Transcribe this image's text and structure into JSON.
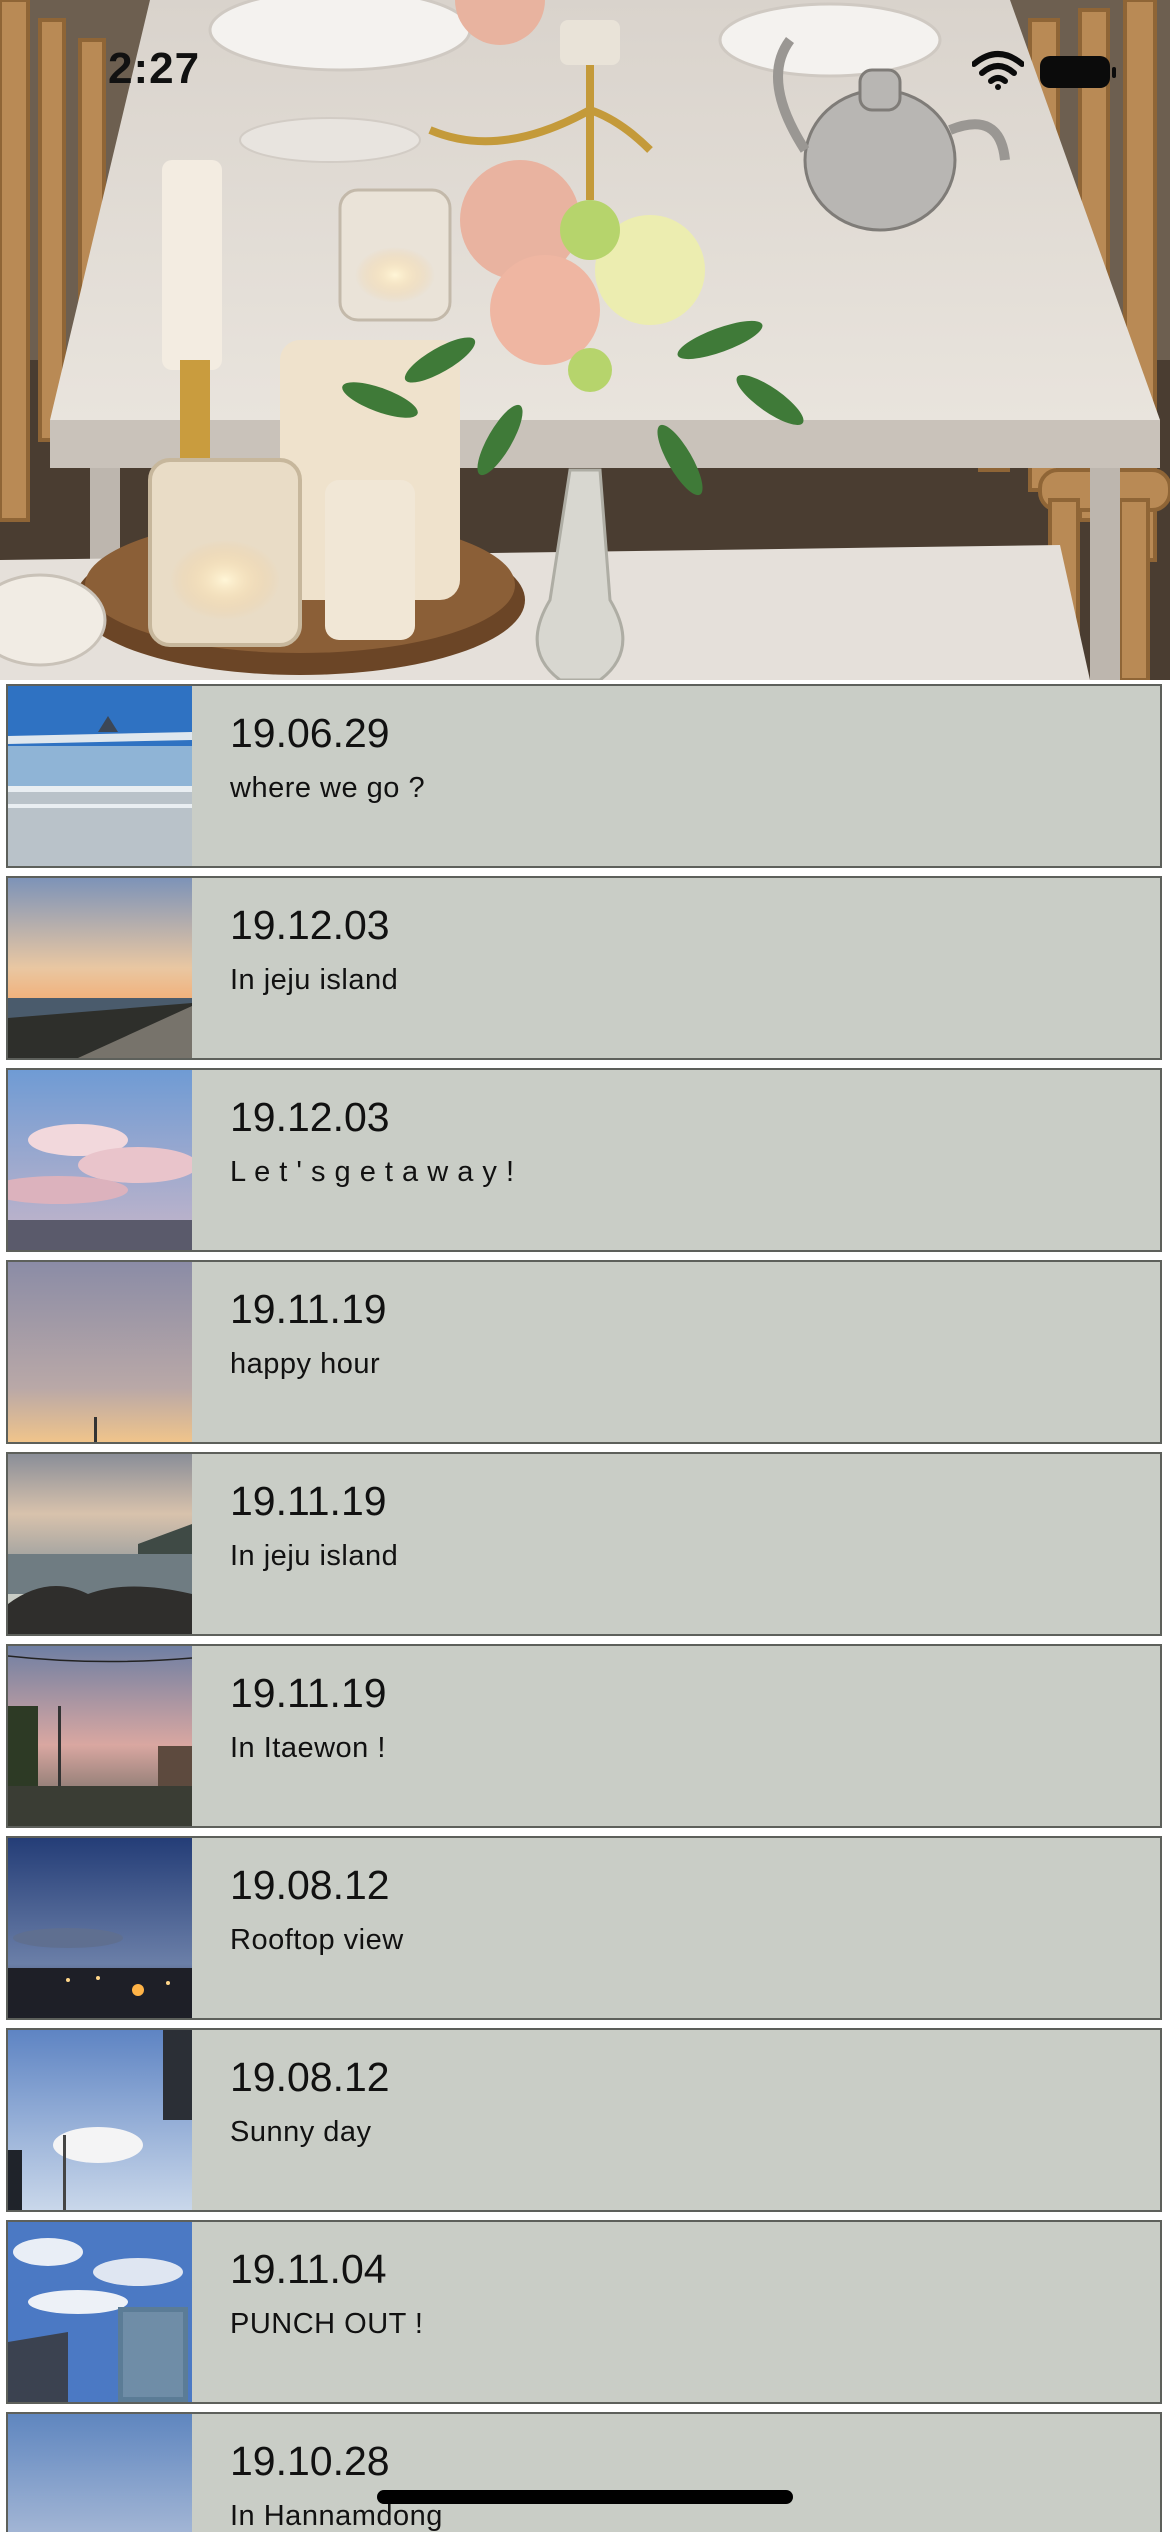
{
  "status_bar": {
    "time": "2:27",
    "wifi_icon": "wifi-icon",
    "battery_icon": "battery-icon"
  },
  "header": {
    "photo_icon": "dining-table-photo"
  },
  "entries": [
    {
      "date": "19.06.29",
      "caption": "where we go ?",
      "thumb": "bridge-sea-photo"
    },
    {
      "date": "19.12.03",
      "caption": "In jeju island",
      "thumb": "sunset-coast-photo"
    },
    {
      "date": "19.12.03",
      "caption": "L e t ' s g e t a w a y !",
      "thumb": "pink-clouds-photo"
    },
    {
      "date": "19.11.19",
      "caption": "happy hour",
      "thumb": "dusk-sky-photo"
    },
    {
      "date": "19.11.19",
      "caption": "In jeju island",
      "thumb": "rocky-shore-photo"
    },
    {
      "date": "19.11.19",
      "caption": "In Itaewon !",
      "thumb": "itaewon-street-photo"
    },
    {
      "date": "19.08.12",
      "caption": "Rooftop view",
      "thumb": "night-city-photo"
    },
    {
      "date": "19.08.12",
      "caption": "Sunny day",
      "thumb": "blue-sky-photo"
    },
    {
      "date": "19.11.04",
      "caption": "PUNCH OUT !",
      "thumb": "buildings-clouds-photo"
    },
    {
      "date": "19.10.28",
      "caption": "In Hannamdong",
      "thumb": "evening-sky-photo"
    }
  ],
  "colors": {
    "row_background": "#c9cdc6",
    "row_border": "#5d605b"
  }
}
